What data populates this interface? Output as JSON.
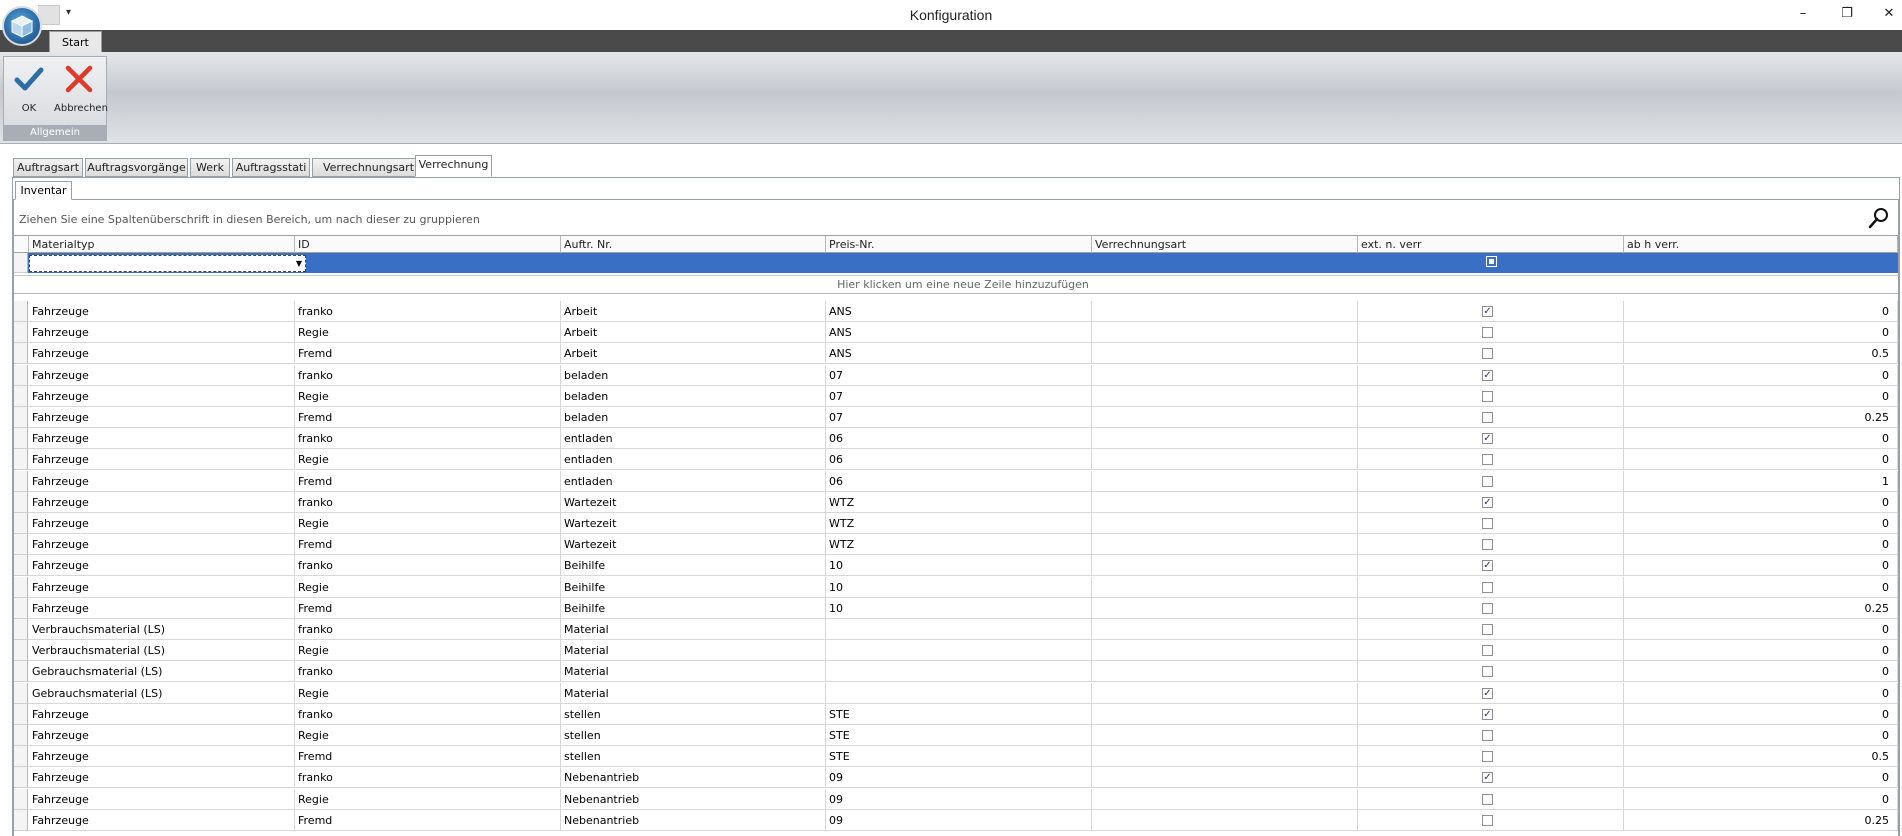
{
  "window": {
    "title": "Konfiguration"
  },
  "window_controls": {
    "minimize": "–",
    "restore": "❐",
    "close": "✕"
  },
  "qat_arrow": "▾",
  "ribbon": {
    "tab": "Start",
    "group_label": "Allgemein",
    "ok_label": "OK",
    "cancel_label": "Abbrechen"
  },
  "tabs": [
    "Auftragsart",
    "Auftragsvorgänge",
    "Werk",
    "Auftragsstati",
    "Verrechnungsart",
    "Verrechnung"
  ],
  "active_tab": "Verrechnung",
  "subtab": "Inventar",
  "grid": {
    "group_hint": "Ziehen Sie eine Spaltenüberschrift in diesen Bereich, um nach dieser zu gruppieren",
    "new_row_hint": "Hier klicken um eine neue Zeile hinzuzufügen",
    "columns": [
      "Materialtyp",
      "ID",
      "Auftr. Nr.",
      "Preis-Nr.",
      "Verrechnungsart",
      "ext. n. verr",
      "ab h verr."
    ],
    "rows": [
      {
        "materialtyp": "Fahrzeuge",
        "id": "franko",
        "auftr": "Arbeit",
        "preis": "ANS",
        "verr": "",
        "ext": true,
        "abh": "0"
      },
      {
        "materialtyp": "Fahrzeuge",
        "id": "Regie",
        "auftr": "Arbeit",
        "preis": "ANS",
        "verr": "",
        "ext": false,
        "abh": "0"
      },
      {
        "materialtyp": "Fahrzeuge",
        "id": "Fremd",
        "auftr": "Arbeit",
        "preis": "ANS",
        "verr": "",
        "ext": false,
        "abh": "0.5"
      },
      {
        "materialtyp": "Fahrzeuge",
        "id": "franko",
        "auftr": "beladen",
        "preis": "07",
        "verr": "",
        "ext": true,
        "abh": "0"
      },
      {
        "materialtyp": "Fahrzeuge",
        "id": "Regie",
        "auftr": "beladen",
        "preis": "07",
        "verr": "",
        "ext": false,
        "abh": "0"
      },
      {
        "materialtyp": "Fahrzeuge",
        "id": "Fremd",
        "auftr": "beladen",
        "preis": "07",
        "verr": "",
        "ext": false,
        "abh": "0.25"
      },
      {
        "materialtyp": "Fahrzeuge",
        "id": "franko",
        "auftr": "entladen",
        "preis": "06",
        "verr": "",
        "ext": true,
        "abh": "0"
      },
      {
        "materialtyp": "Fahrzeuge",
        "id": "Regie",
        "auftr": "entladen",
        "preis": "06",
        "verr": "",
        "ext": false,
        "abh": "0"
      },
      {
        "materialtyp": "Fahrzeuge",
        "id": "Fremd",
        "auftr": "entladen",
        "preis": "06",
        "verr": "",
        "ext": false,
        "abh": "1"
      },
      {
        "materialtyp": "Fahrzeuge",
        "id": "franko",
        "auftr": "Wartezeit",
        "preis": "WTZ",
        "verr": "",
        "ext": true,
        "abh": "0"
      },
      {
        "materialtyp": "Fahrzeuge",
        "id": "Regie",
        "auftr": "Wartezeit",
        "preis": "WTZ",
        "verr": "",
        "ext": false,
        "abh": "0"
      },
      {
        "materialtyp": "Fahrzeuge",
        "id": "Fremd",
        "auftr": "Wartezeit",
        "preis": "WTZ",
        "verr": "",
        "ext": false,
        "abh": "0"
      },
      {
        "materialtyp": "Fahrzeuge",
        "id": "franko",
        "auftr": "Beihilfe",
        "preis": "10",
        "verr": "",
        "ext": true,
        "abh": "0"
      },
      {
        "materialtyp": "Fahrzeuge",
        "id": "Regie",
        "auftr": "Beihilfe",
        "preis": "10",
        "verr": "",
        "ext": false,
        "abh": "0"
      },
      {
        "materialtyp": "Fahrzeuge",
        "id": "Fremd",
        "auftr": "Beihilfe",
        "preis": "10",
        "verr": "",
        "ext": false,
        "abh": "0.25"
      },
      {
        "materialtyp": "Verbrauchsmaterial (LS)",
        "id": "franko",
        "auftr": "Material",
        "preis": "",
        "verr": "",
        "ext": false,
        "abh": "0"
      },
      {
        "materialtyp": "Verbrauchsmaterial (LS)",
        "id": "Regie",
        "auftr": "Material",
        "preis": "",
        "verr": "",
        "ext": false,
        "abh": "0"
      },
      {
        "materialtyp": "Gebrauchsmaterial (LS)",
        "id": "franko",
        "auftr": "Material",
        "preis": "",
        "verr": "",
        "ext": false,
        "abh": "0"
      },
      {
        "materialtyp": "Gebrauchsmaterial (LS)",
        "id": "Regie",
        "auftr": "Material",
        "preis": "",
        "verr": "",
        "ext": true,
        "abh": "0"
      },
      {
        "materialtyp": "Fahrzeuge",
        "id": "franko",
        "auftr": "stellen",
        "preis": "STE",
        "verr": "",
        "ext": true,
        "abh": "0"
      },
      {
        "materialtyp": "Fahrzeuge",
        "id": "Regie",
        "auftr": "stellen",
        "preis": "STE",
        "verr": "",
        "ext": false,
        "abh": "0"
      },
      {
        "materialtyp": "Fahrzeuge",
        "id": "Fremd",
        "auftr": "stellen",
        "preis": "STE",
        "verr": "",
        "ext": false,
        "abh": "0.5"
      },
      {
        "materialtyp": "Fahrzeuge",
        "id": "franko",
        "auftr": "Nebenantrieb",
        "preis": "09",
        "verr": "",
        "ext": true,
        "abh": "0"
      },
      {
        "materialtyp": "Fahrzeuge",
        "id": "Regie",
        "auftr": "Nebenantrieb",
        "preis": "09",
        "verr": "",
        "ext": false,
        "abh": "0"
      },
      {
        "materialtyp": "Fahrzeuge",
        "id": "Fremd",
        "auftr": "Nebenantrieb",
        "preis": "09",
        "verr": "",
        "ext": false,
        "abh": "0.25"
      }
    ]
  },
  "colors": {
    "selection": "#3a6fc6",
    "ribbon_dark": "#4a4a4a",
    "ok_check": "#2c6ea8",
    "cancel_x": "#e0392b"
  }
}
